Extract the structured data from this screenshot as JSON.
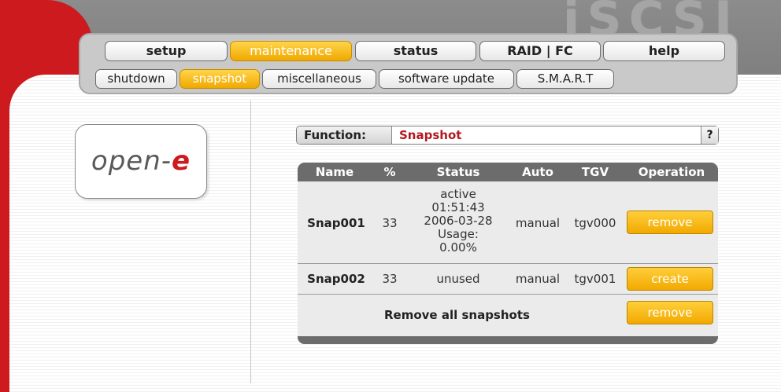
{
  "brand": {
    "product_logo": "iSCSI",
    "company_logo_main": "open-",
    "company_logo_accent": "e"
  },
  "colors": {
    "accent_orange": "#f2a900",
    "brand_red": "#cc1a1f",
    "header_grey": "#6c6c6c"
  },
  "nav": {
    "tabs": [
      {
        "label": "setup",
        "active": false
      },
      {
        "label": "maintenance",
        "active": true
      },
      {
        "label": "status",
        "active": false
      },
      {
        "label": "RAID | FC",
        "active": false
      },
      {
        "label": "help",
        "active": false
      }
    ],
    "subtabs": [
      {
        "label": "shutdown",
        "active": false
      },
      {
        "label": "snapshot",
        "active": true
      },
      {
        "label": "miscellaneous",
        "active": false
      },
      {
        "label": "software update",
        "active": false
      },
      {
        "label": "S.M.A.R.T",
        "active": false
      }
    ]
  },
  "function_bar": {
    "label": "Function:",
    "value": "Snapshot",
    "help": "?"
  },
  "table": {
    "headers": [
      "Name",
      "%",
      "Status",
      "Auto",
      "TGV",
      "Operation"
    ],
    "rows": [
      {
        "name": "Snap001",
        "percent": "33",
        "status_lines": [
          "active",
          "01:51:43",
          "2006-03-28",
          "Usage:",
          "0.00%"
        ],
        "auto": "manual",
        "tgv": "tgv000",
        "operation": "remove"
      },
      {
        "name": "Snap002",
        "percent": "33",
        "status_lines": [
          "unused"
        ],
        "auto": "manual",
        "tgv": "tgv001",
        "operation": "create"
      }
    ],
    "footer": {
      "label": "Remove all snapshots",
      "button": "remove"
    }
  }
}
